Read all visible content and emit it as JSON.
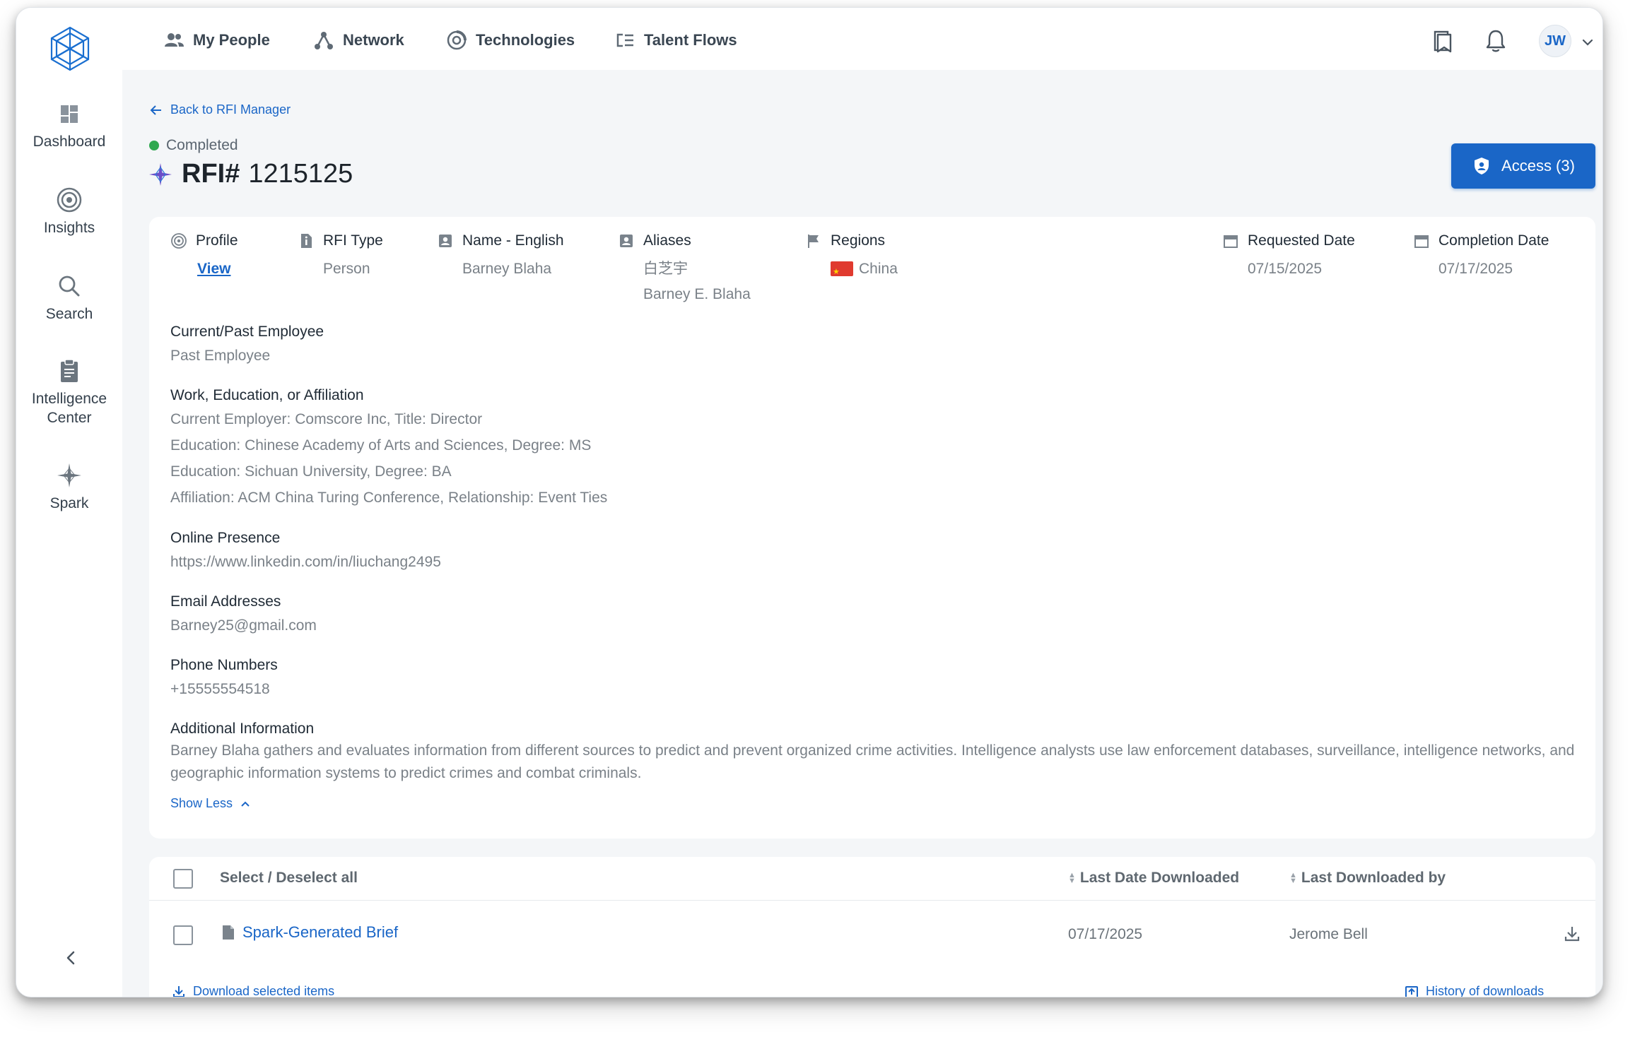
{
  "sidebar": {
    "items": [
      {
        "label": "Dashboard",
        "icon": "dashboard-icon"
      },
      {
        "label": "Insights",
        "icon": "target-icon"
      },
      {
        "label": "Search",
        "icon": "search-icon"
      },
      {
        "label": "Intelligence Center",
        "icon": "clipboard-icon"
      },
      {
        "label": "Spark",
        "icon": "spark-icon"
      }
    ]
  },
  "topnav": {
    "items": [
      {
        "label": "My People",
        "icon": "people-icon"
      },
      {
        "label": "Network",
        "icon": "network-icon"
      },
      {
        "label": "Technologies",
        "icon": "technologies-icon"
      },
      {
        "label": "Talent Flows",
        "icon": "talent-flows-icon"
      }
    ],
    "user_initials": "JW"
  },
  "page": {
    "back_label": "Back to RFI Manager",
    "status": "Completed",
    "title_prefix": "RFI#",
    "title_number": "1215125",
    "access_label": "Access (3)"
  },
  "details": {
    "profile": {
      "label": "Profile",
      "value": "View"
    },
    "rfi_type": {
      "label": "RFI Type",
      "value": "Person"
    },
    "name_english": {
      "label": "Name - English",
      "value": "Barney Blaha"
    },
    "aliases": {
      "label": "Aliases",
      "values": [
        "白芝宇",
        "Barney E. Blaha"
      ]
    },
    "regions": {
      "label": "Regions",
      "value": "China"
    },
    "requested_date": {
      "label": "Requested Date",
      "value": "07/15/2025"
    },
    "completion_date": {
      "label": "Completion Date",
      "value": "07/17/2025"
    },
    "employee": {
      "label": "Current/Past Employee",
      "value": "Past Employee"
    },
    "work": {
      "label": "Work, Education, or Affiliation",
      "lines": [
        "Current Employer: Comscore Inc, Title: Director",
        "Education: Chinese Academy of Arts and Sciences, Degree: MS",
        "Education: Sichuan University, Degree: BA",
        "Affiliation: ACM China Turing Conference, Relationship: Event Ties"
      ]
    },
    "online": {
      "label": "Online Presence",
      "value": "https://www.linkedin.com/in/liuchang2495"
    },
    "email": {
      "label": "Email Addresses",
      "value": "Barney25@gmail.com"
    },
    "phone": {
      "label": "Phone Numbers",
      "value": "+15555554518"
    },
    "additional": {
      "label": "Additional Information",
      "value": "Barney Blaha gathers and evaluates information from different sources to predict and prevent organized crime activities. Intelligence analysts use law enforcement databases, surveillance, intelligence networks, and geographic information systems to predict crimes and combat criminals."
    },
    "show_less": "Show Less"
  },
  "downloads": {
    "select_all": "Select / Deselect all",
    "col_last_date": "Last Date Downloaded",
    "col_last_by": "Last Downloaded by",
    "rows": [
      {
        "name": "Spark-Generated Brief",
        "date": "07/17/2025",
        "by": "Jerome Bell"
      }
    ],
    "download_selected": "Download selected items",
    "history": "History of downloads"
  },
  "colors": {
    "accent": "#1a66c7",
    "status_green": "#2fa84f",
    "background": "#f4f6f8"
  }
}
